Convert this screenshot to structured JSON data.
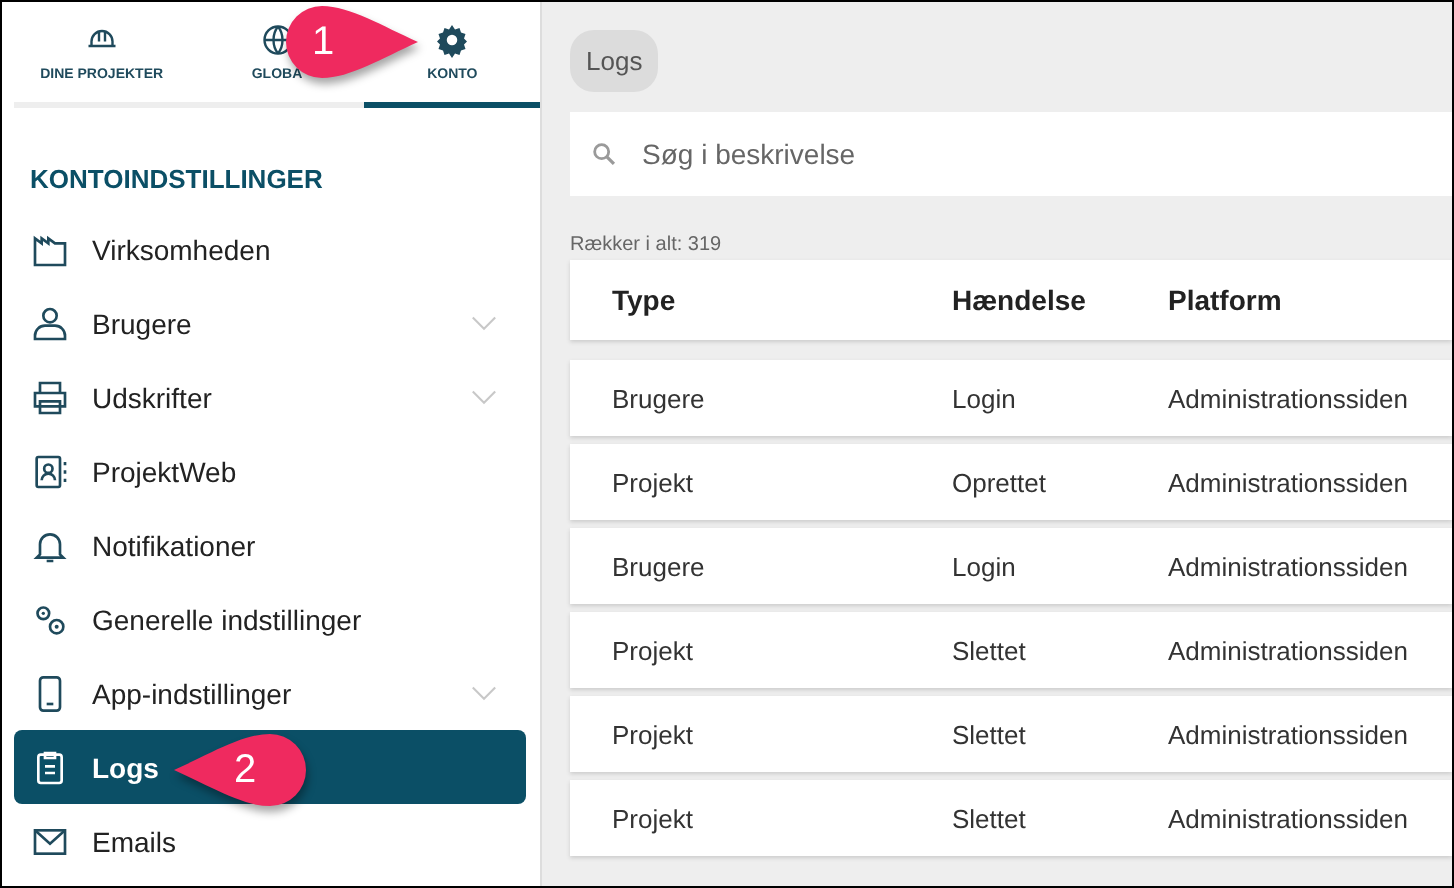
{
  "top_tabs": [
    {
      "label": "DINE PROJEKTER",
      "selected": false
    },
    {
      "label": "GLOBA",
      "selected": false
    },
    {
      "label": "KONTO",
      "selected": true
    }
  ],
  "sidebar": {
    "heading": "KONTOINDSTILLINGER",
    "items": [
      {
        "label": "Virksomheden",
        "kind": "link",
        "selected": false
      },
      {
        "label": "Brugere",
        "kind": "group",
        "selected": false
      },
      {
        "label": "Udskrifter",
        "kind": "group",
        "selected": false
      },
      {
        "label": "ProjektWeb",
        "kind": "link",
        "selected": false
      },
      {
        "label": "Notifikationer",
        "kind": "link",
        "selected": false
      },
      {
        "label": "Generelle indstillinger",
        "kind": "link",
        "selected": false
      },
      {
        "label": "App-indstillinger",
        "kind": "group",
        "selected": false
      },
      {
        "label": "Logs",
        "kind": "link",
        "selected": true
      },
      {
        "label": "Emails",
        "kind": "link",
        "selected": false
      }
    ]
  },
  "main": {
    "breadcrumb": "Logs",
    "search": {
      "placeholder": "Søg i beskrivelse"
    },
    "row_count": "Rækker i alt: 319",
    "table": {
      "columns": [
        "Type",
        "Hændelse",
        "Platform"
      ],
      "rows": [
        [
          "Brugere",
          "Login",
          "Administrationssiden"
        ],
        [
          "Projekt",
          "Oprettet",
          "Administrationssiden"
        ],
        [
          "Brugere",
          "Login",
          "Administrationssiden"
        ],
        [
          "Projekt",
          "Slettet",
          "Administrationssiden"
        ],
        [
          "Projekt",
          "Slettet",
          "Administrationssiden"
        ],
        [
          "Projekt",
          "Slettet",
          "Administrationssiden"
        ]
      ]
    }
  },
  "callouts": [
    {
      "number": "1"
    },
    {
      "number": "2"
    }
  ]
}
